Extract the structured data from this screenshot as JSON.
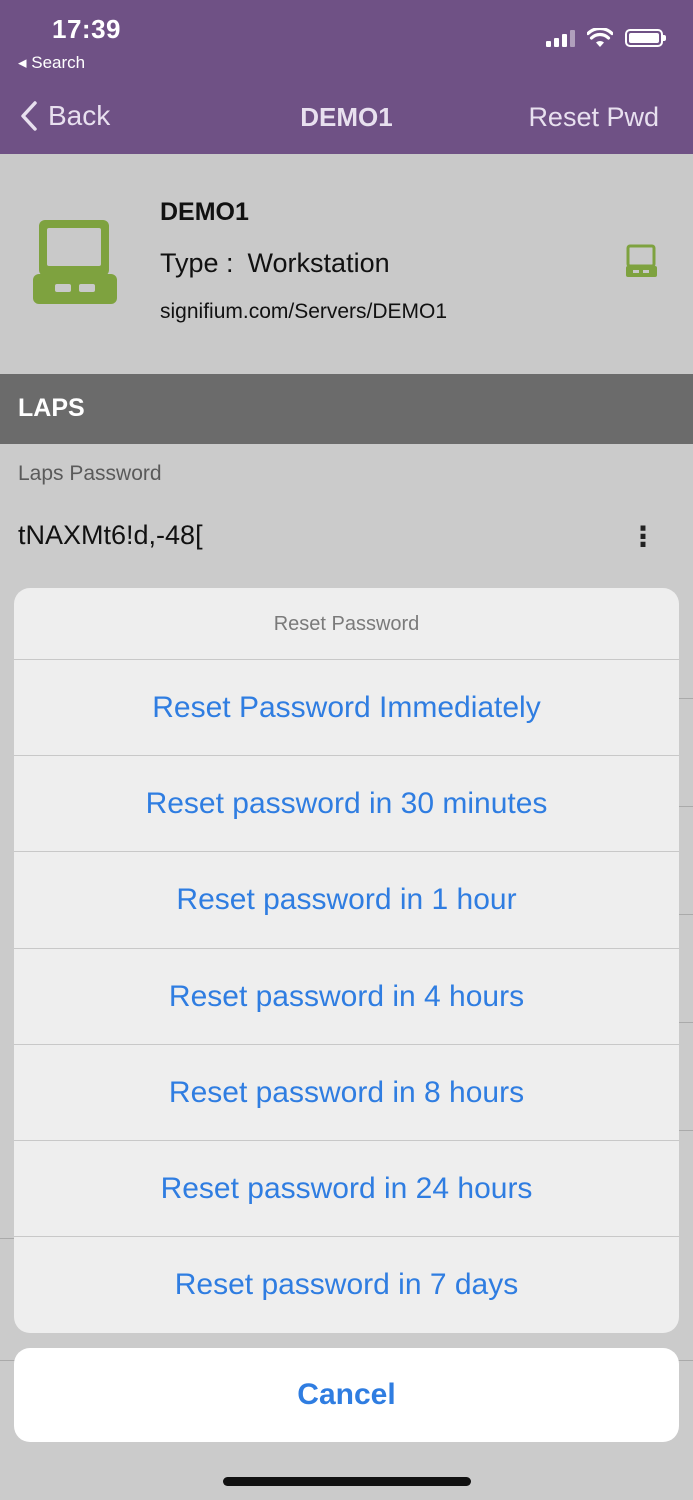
{
  "status_bar": {
    "time": "17:39",
    "back_app": "◂ Search"
  },
  "nav": {
    "back_label": "Back",
    "title": "DEMO1",
    "action_label": "Reset Pwd"
  },
  "device": {
    "name": "DEMO1",
    "type_label": "Type :",
    "type_value": "Workstation",
    "path": "signifium.com/Servers/DEMO1",
    "icon": "computer-icon",
    "icon_color": "#7ea23f"
  },
  "section": {
    "title": "LAPS"
  },
  "laps": {
    "label": "Laps Password",
    "value": "tNAXMt6!d,-48[",
    "more": "⋮"
  },
  "action_sheet": {
    "title": "Reset Password",
    "options": [
      "Reset Password Immediately",
      "Reset password in 30 minutes",
      "Reset password in 1 hour",
      "Reset password in 4 hours",
      "Reset password in 8 hours",
      "Reset password in 24 hours",
      "Reset password in 7 days"
    ],
    "cancel": "Cancel"
  },
  "colors": {
    "header": "#6f5185",
    "accent": "#2f7de1"
  }
}
